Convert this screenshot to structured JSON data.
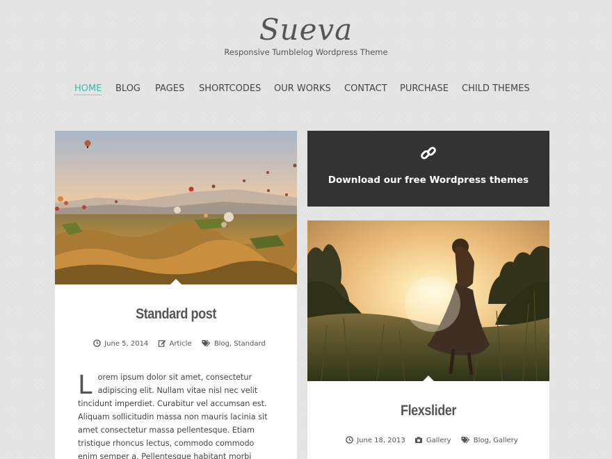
{
  "site": {
    "title": "Sueva",
    "tagline": "Responsive Tumblelog Wordpress Theme"
  },
  "nav": {
    "items": [
      {
        "label": "HOME",
        "active": true
      },
      {
        "label": "BLOG"
      },
      {
        "label": "PAGES"
      },
      {
        "label": "SHORTCODES"
      },
      {
        "label": "OUR WORKS"
      },
      {
        "label": "CONTACT"
      },
      {
        "label": "PURCHASE"
      },
      {
        "label": "CHILD THEMES"
      }
    ]
  },
  "promo": {
    "icon": "link-icon",
    "text": "Download our free Wordpress themes"
  },
  "posts": [
    {
      "title": "Standard post",
      "date": "June 5, 2014",
      "format_label": "Article",
      "format_icon": "edit-icon",
      "tags": [
        "Blog",
        "Standard"
      ],
      "dropcap": "L",
      "excerpt": "orem ipsum dolor sit amet, consectetur adipiscing elit. Nullam vitae nisl nec velit tincidunt imperdiet. Curabitur vel accumsan est. Aliquam sollicitudin massa non mauris lacinia sit amet consectetur massa pellentesque. Etiam tristique rhoncus lectus, commodo commodo enim semper a. Pellentesque habitant morbi tristique",
      "image": "hot-air-balloons-landscape"
    },
    {
      "title": "Flexslider",
      "date": "June 18, 2013",
      "format_label": "Gallery",
      "format_icon": "camera-icon",
      "tags": [
        "Blog",
        "Gallery"
      ],
      "image": "girl-in-sunlit-field"
    }
  ],
  "colors": {
    "accent": "#3fb8a6",
    "promo_bg": "#333333",
    "background": "#e4e4e4"
  }
}
